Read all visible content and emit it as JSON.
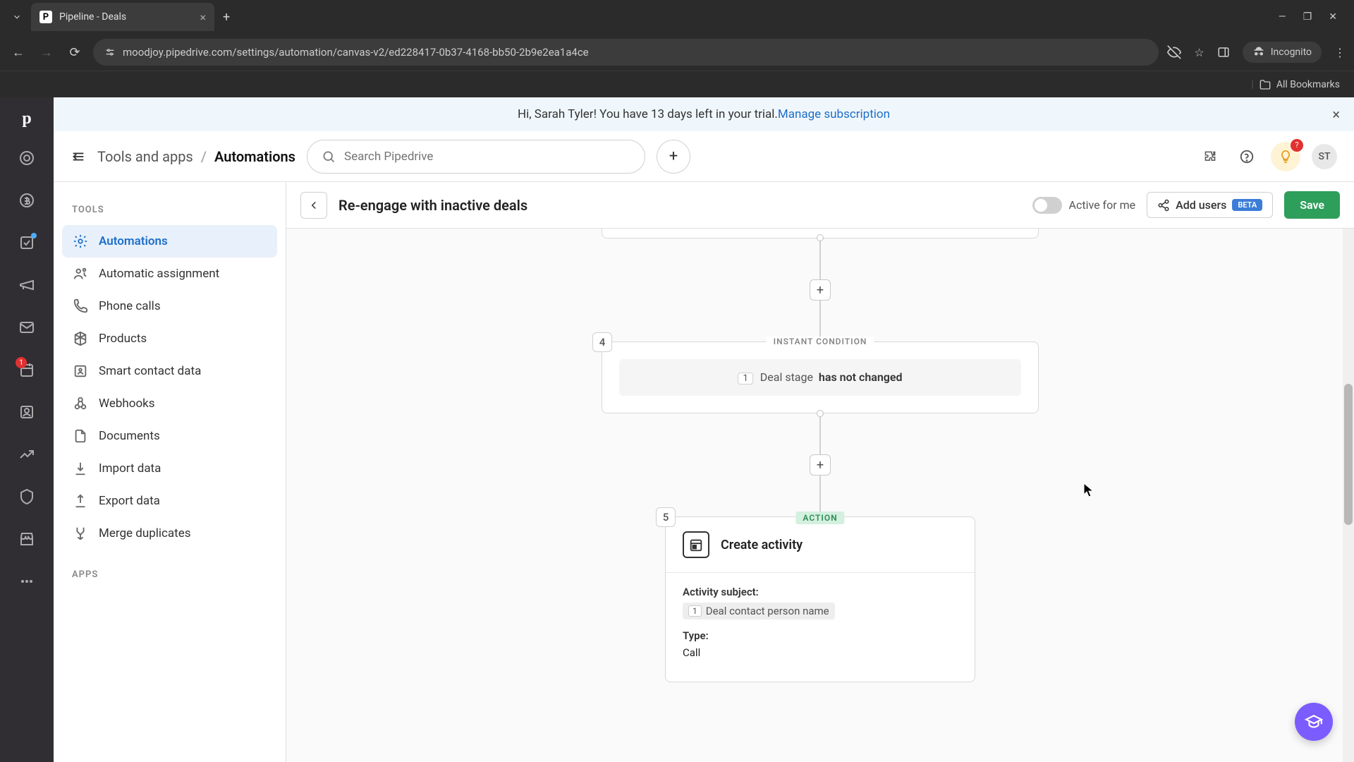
{
  "browser": {
    "tab_title": "Pipeline - Deals",
    "url": "moodjoy.pipedrive.com/settings/automation/canvas-v2/ed228417-0b37-4168-bb50-2b9e2ea1a4ce",
    "incognito_label": "Incognito",
    "bookmarks_label": "All Bookmarks"
  },
  "banner": {
    "greeting": "Hi, Sarah Tyler! You have 13 days left in your trial. ",
    "link": "Manage subscription"
  },
  "breadcrumb": {
    "parent": "Tools and apps",
    "current": "Automations"
  },
  "search": {
    "placeholder": "Search Pipedrive"
  },
  "avatar": {
    "initials": "ST"
  },
  "notifications": {
    "bulb_badge": "?",
    "rail_badge": "1"
  },
  "sidebar": {
    "heading_tools": "TOOLS",
    "heading_apps": "APPS",
    "items": [
      {
        "label": "Automations"
      },
      {
        "label": "Automatic assignment"
      },
      {
        "label": "Phone calls"
      },
      {
        "label": "Products"
      },
      {
        "label": "Smart contact data"
      },
      {
        "label": "Webhooks"
      },
      {
        "label": "Documents"
      },
      {
        "label": "Import data"
      },
      {
        "label": "Export data"
      },
      {
        "label": "Merge duplicates"
      }
    ]
  },
  "canvas_header": {
    "title": "Re-engage with inactive deals",
    "toggle_label": "Active for me",
    "add_users": "Add users",
    "beta": "BETA",
    "save": "Save"
  },
  "flow": {
    "step4": {
      "num": "4",
      "label": "INSTANT CONDITION",
      "ref": "1",
      "field": "Deal stage",
      "op": "has not changed"
    },
    "step5": {
      "num": "5",
      "label": "ACTION",
      "title": "Create activity",
      "subject_label": "Activity subject:",
      "subject_ref": "1",
      "subject_value": "Deal contact person name",
      "type_label": "Type:",
      "type_value": "Call"
    }
  }
}
